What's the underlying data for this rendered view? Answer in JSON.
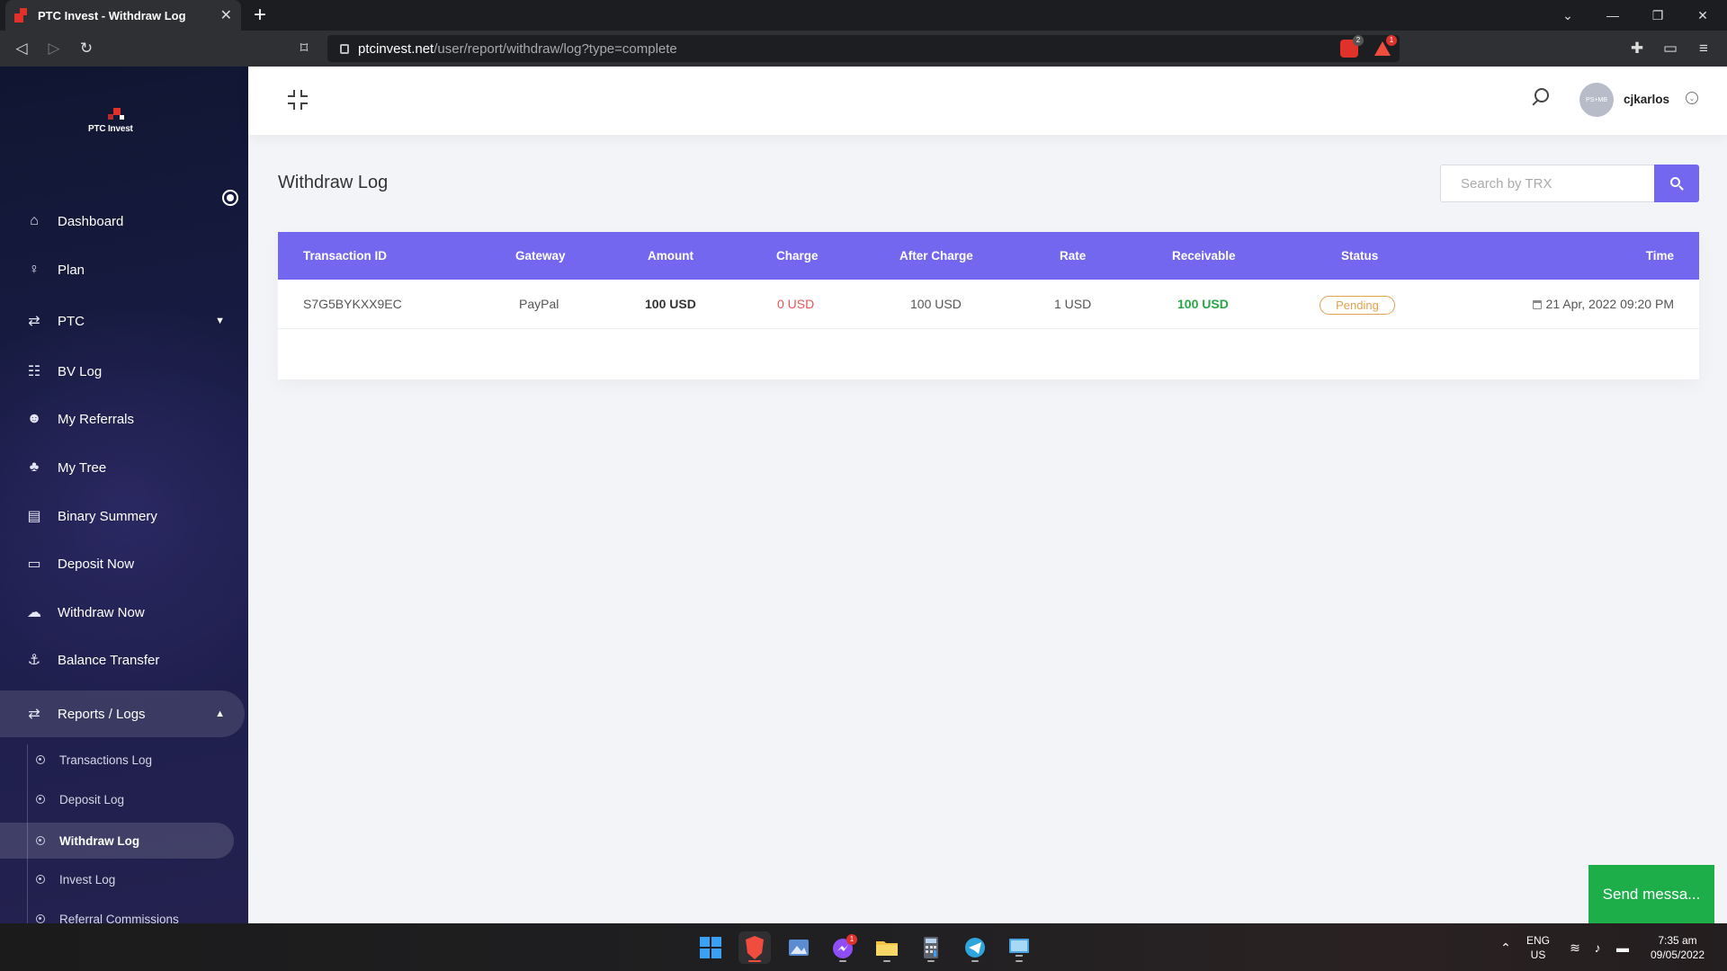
{
  "browser": {
    "tab_title": "PTC Invest - Withdraw Log",
    "url_host": "ptcinvest.net",
    "url_path": "/user/report/withdraw/log?type=complete",
    "shield_count": "2",
    "alert_count": "1"
  },
  "sidebar": {
    "logo_text": "PTC Invest",
    "items": [
      {
        "label": "Dashboard"
      },
      {
        "label": "Plan"
      },
      {
        "label": "PTC"
      },
      {
        "label": "BV Log"
      },
      {
        "label": "My Referrals"
      },
      {
        "label": "My Tree"
      },
      {
        "label": "Binary Summery"
      },
      {
        "label": "Deposit Now"
      },
      {
        "label": "Withdraw Now"
      },
      {
        "label": "Balance Transfer"
      },
      {
        "label": "Reports / Logs"
      }
    ],
    "sub_items": [
      {
        "label": "Transactions Log"
      },
      {
        "label": "Deposit Log"
      },
      {
        "label": "Withdraw Log"
      },
      {
        "label": "Invest Log"
      },
      {
        "label": "Referral Commissions"
      }
    ]
  },
  "header": {
    "avatar_text": "PS+MB",
    "username": "cjkarlos"
  },
  "main": {
    "page_title": "Withdraw Log",
    "search_placeholder": "Search by TRX",
    "table": {
      "columns": [
        "Transaction ID",
        "Gateway",
        "Amount",
        "Charge",
        "After Charge",
        "Rate",
        "Receivable",
        "Status",
        "Time"
      ],
      "rows": [
        {
          "transaction_id": "S7G5BYKXX9EC",
          "gateway": "PayPal",
          "amount": "100 USD",
          "charge": "0 USD",
          "after_charge": "100 USD",
          "rate": "1 USD",
          "receivable": "100 USD",
          "status": "Pending",
          "time": "21 Apr, 2022 09:20 PM"
        }
      ]
    }
  },
  "chat_widget": {
    "label": "Send messa..."
  },
  "taskbar": {
    "lang_top": "ENG",
    "lang_bottom": "US",
    "clock_time": "7:35 am",
    "clock_date": "09/05/2022",
    "messenger_badge": "1"
  },
  "colors": {
    "accent": "#7367f0",
    "sidebar_bg": "#1c1e4c",
    "danger": "#ea5455",
    "success": "#28a745",
    "warning": "#e0a24f",
    "chat": "#1dae4a"
  }
}
